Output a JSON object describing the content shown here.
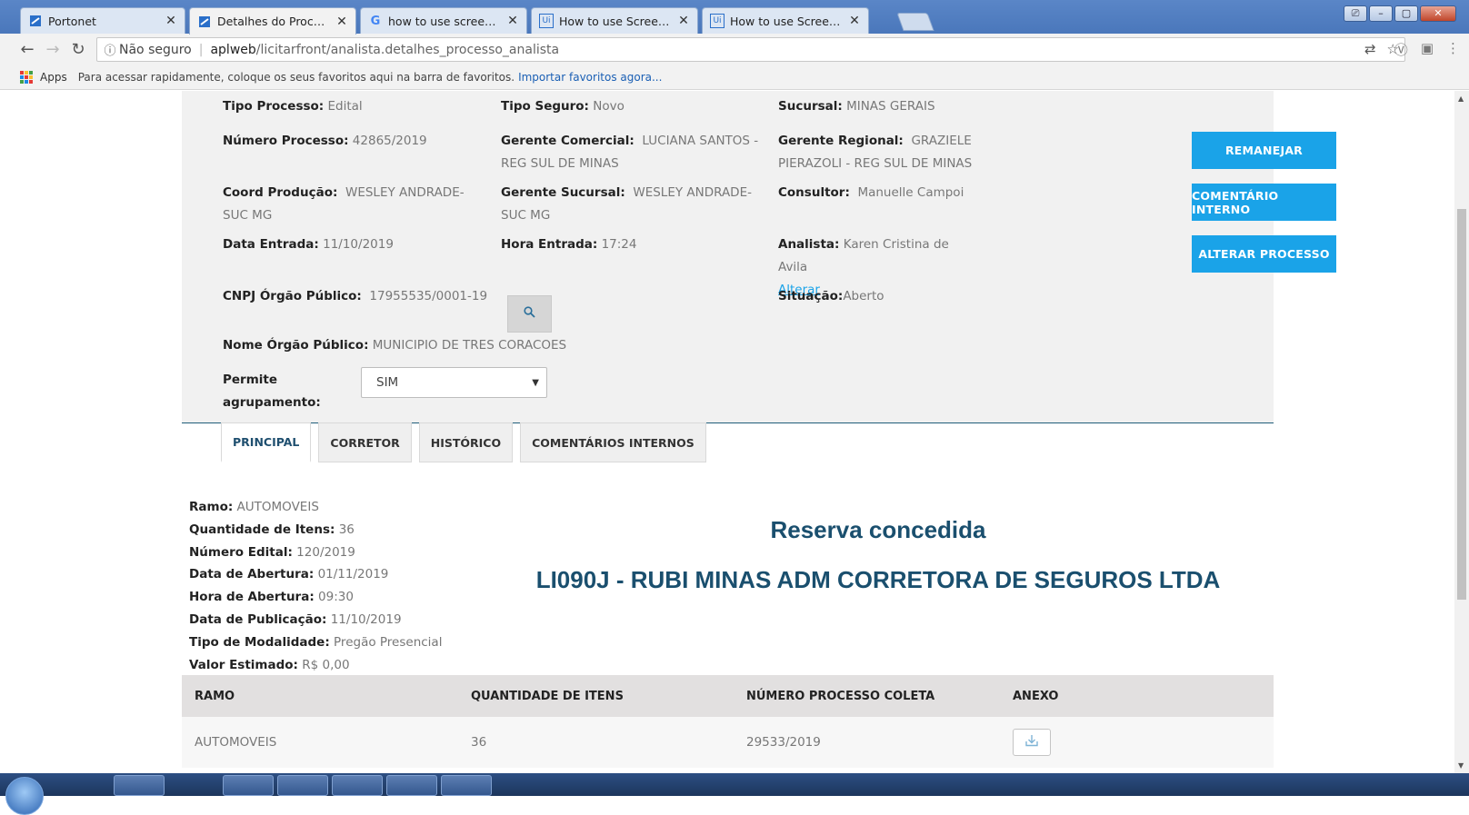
{
  "browser": {
    "tabs": [
      {
        "title": "Portonet",
        "icon": "document-icon",
        "active": false
      },
      {
        "title": "Detalhes do Processo",
        "icon": "document-icon",
        "active": true
      },
      {
        "title": "how to use screen scrapin",
        "icon": "google-icon",
        "active": false
      },
      {
        "title": "How to use Screen Scrapi",
        "icon": "uipath-icon",
        "active": false
      },
      {
        "title": "How to use Screen Scrapi",
        "icon": "uipath-icon",
        "active": false
      }
    ],
    "tab_close": "✕",
    "window_controls": [
      "⎚",
      "–",
      "▢",
      "✕"
    ],
    "security_label": "Não seguro",
    "url_host": "aplweb",
    "url_path": "/licitarfront/analista.detalhes_processo_analista",
    "bookmarks": {
      "apps_label": "Apps",
      "hint": "Para acessar rapidamente, coloque os seus favoritos aqui na barra de favoritos.",
      "import_link": "Importar favoritos agora..."
    }
  },
  "process": {
    "tipo_processo": {
      "label": "Tipo Processo:",
      "value": "Edital"
    },
    "tipo_seguro": {
      "label": "Tipo Seguro:",
      "value": "Novo"
    },
    "sucursal": {
      "label": "Sucursal:",
      "value": "MINAS GERAIS"
    },
    "numero_processo": {
      "label": "Número Processo:",
      "value": "42865/2019"
    },
    "gerente_comercial": {
      "label": "Gerente Comercial:",
      "value": "LUCIANA SANTOS - REG SUL DE MINAS"
    },
    "gerente_regional": {
      "label": "Gerente Regional:",
      "value": "GRAZIELE PIERAZOLI - REG SUL DE MINAS"
    },
    "coord_producao": {
      "label": "Coord Produção:",
      "value": "WESLEY ANDRADE- SUC MG"
    },
    "gerente_sucursal": {
      "label": "Gerente Sucursal:",
      "value": "WESLEY ANDRADE- SUC MG"
    },
    "consultor": {
      "label": "Consultor:",
      "value": "Manuelle Campoi"
    },
    "data_entrada": {
      "label": "Data Entrada:",
      "value": "11/10/2019"
    },
    "hora_entrada": {
      "label": "Hora Entrada:",
      "value": "17:24"
    },
    "analista": {
      "label": "Analista:",
      "value": "Karen Cristina de Avila",
      "link": "Alterar"
    },
    "cnpj": {
      "label": "CNPJ Órgão Público:",
      "value": "17955535/0001-19"
    },
    "situacao": {
      "label": "Situação:",
      "value": "Aberto"
    },
    "nome_orgao": {
      "label": "Nome Órgão Público:",
      "value": "MUNICIPIO DE TRES CORACOES"
    },
    "permite_agrupamento": {
      "label": "Permite agrupamento:",
      "value": "SIM"
    }
  },
  "actions": {
    "remanejar": "REMANEJAR",
    "comentario_interno": "COMENTÁRIO INTERNO",
    "alterar_processo": "ALTERAR PROCESSO"
  },
  "page_tabs": [
    "PRINCIPAL",
    "CORRETOR",
    "HISTÓRICO",
    "COMENTÁRIOS INTERNOS"
  ],
  "principal": {
    "items": [
      {
        "label": "Ramo:",
        "value": "AUTOMOVEIS"
      },
      {
        "label": "Quantidade de Itens:",
        "value": "36"
      },
      {
        "label": "Número Edital:",
        "value": "120/2019"
      },
      {
        "label": "Data de Abertura:",
        "value": "01/11/2019"
      },
      {
        "label": "Hora de Abertura:",
        "value": "09:30"
      },
      {
        "label": "Data de Publicação:",
        "value": "11/10/2019"
      },
      {
        "label": "Tipo de Modalidade:",
        "value": "Pregão Presencial"
      },
      {
        "label": "Valor Estimado:",
        "value": "R$ 0,00"
      }
    ],
    "reserva_title": "Reserva concedida",
    "corretora": "LI090J - RUBI MINAS ADM CORRETORA DE SEGUROS LTDA"
  },
  "table": {
    "headers": [
      "RAMO",
      "QUANTIDADE DE ITENS",
      "NÚMERO PROCESSO COLETA",
      "ANEXO"
    ],
    "rows": [
      {
        "ramo": "AUTOMOVEIS",
        "quantidade": "36",
        "numero_coleta": "29533/2019",
        "anexo_icon": "download-icon"
      }
    ]
  }
}
